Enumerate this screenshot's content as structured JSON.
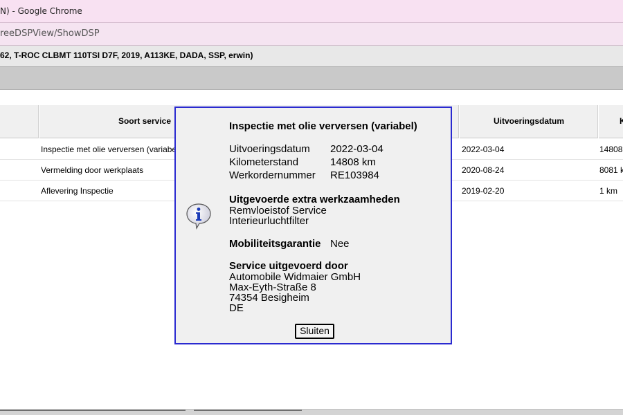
{
  "window": {
    "title": "N) - Google Chrome",
    "url": "reeDSPView/ShowDSP"
  },
  "vehicle_info": "62, T-ROC CLBMT 110TSI D7F, 2019, A113KE, DADA, SSP, erwin)",
  "table": {
    "columns": [
      "Soort service",
      "Uitvoeringsdatum",
      "K"
    ],
    "rows": [
      {
        "service": "Inspectie met olie verversen (variabel)",
        "date": "2022-03-04",
        "km": "14808"
      },
      {
        "service": "Vermelding door werkplaats",
        "date": "2020-08-24",
        "km": "8081 k"
      },
      {
        "service": "Aflevering Inspectie",
        "date": "2019-02-20",
        "km": "1 km"
      }
    ]
  },
  "dialog": {
    "icon": "info-speech-bubble-icon",
    "title": "Inspectie met olie verversen (variabel)",
    "details": [
      {
        "label": "Uitvoeringsdatum",
        "value": "2022-03-04"
      },
      {
        "label": "Kilometerstand",
        "value": "14808 km"
      },
      {
        "label": "Werkordernummer",
        "value": "RE103984"
      }
    ],
    "extra_title": "Uitgevoerde extra werkzaamheden",
    "extra_items": [
      "Remvloeistof Service",
      "Interieurluchtfilter"
    ],
    "mobility_label": "Mobiliteitsgarantie",
    "mobility_value": "Nee",
    "service_title": "Service uitgevoerd door",
    "service_address": [
      "Automobile Widmaier GmbH",
      "Max-Eyth-Straße 8",
      "74354 Besigheim",
      "DE"
    ],
    "close_label": "Sluiten"
  },
  "colors": {
    "titlebar": "#f8e1f2",
    "dialog_border": "#2a2ad0",
    "dialog_bg": "#f0f0f0"
  }
}
